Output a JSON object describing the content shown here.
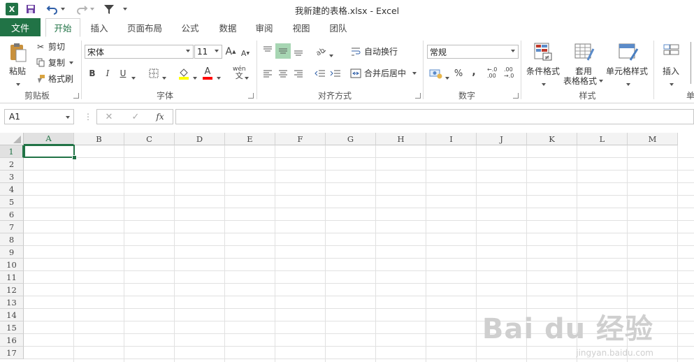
{
  "app": {
    "logo": "X",
    "title": "我新建的表格.xlsx - Excel"
  },
  "tabs": [
    {
      "label": "文件"
    },
    {
      "label": "开始"
    },
    {
      "label": "插入"
    },
    {
      "label": "页面布局"
    },
    {
      "label": "公式"
    },
    {
      "label": "数据"
    },
    {
      "label": "审阅"
    },
    {
      "label": "视图"
    },
    {
      "label": "团队"
    }
  ],
  "ribbon": {
    "clipboard": {
      "paste": "粘贴",
      "cut": "剪切",
      "copy": "复制",
      "format_painter": "格式刷",
      "label": "剪贴板"
    },
    "font": {
      "name": "宋体",
      "size": "11",
      "bold": "B",
      "italic": "I",
      "underline": "U",
      "phonetic": "wén",
      "phonetic_char": "文",
      "label": "字体",
      "fill_color": "#ffff00",
      "font_color": "#ff0000"
    },
    "alignment": {
      "wrap": "自动换行",
      "merge": "合并后居中",
      "label": "对齐方式"
    },
    "number": {
      "format": "常规",
      "percent": "%",
      "comma": ",",
      "inc_dec": ".00",
      "label": "数字"
    },
    "styles": {
      "conditional": "条件格式",
      "table1": "套用",
      "table2": "表格格式",
      "cell_styles": "单元格样式",
      "label": "样式"
    },
    "cells": {
      "insert": "插入",
      "label": "单"
    }
  },
  "formula_bar": {
    "name_box": "A1",
    "fx": "fx",
    "cancel": "✕",
    "enter": "✓"
  },
  "grid": {
    "columns": [
      "A",
      "B",
      "C",
      "D",
      "E",
      "F",
      "G",
      "H",
      "I",
      "J",
      "K",
      "L",
      "M"
    ],
    "rows": [
      "1",
      "2",
      "3",
      "4",
      "5",
      "6",
      "7",
      "8",
      "9",
      "10",
      "11",
      "12",
      "13",
      "14",
      "15",
      "16",
      "17"
    ]
  },
  "watermark": {
    "main": "Bai du 经验",
    "sub": "jingyan.baidu.com"
  },
  "colors": {
    "accent": "#217346"
  }
}
